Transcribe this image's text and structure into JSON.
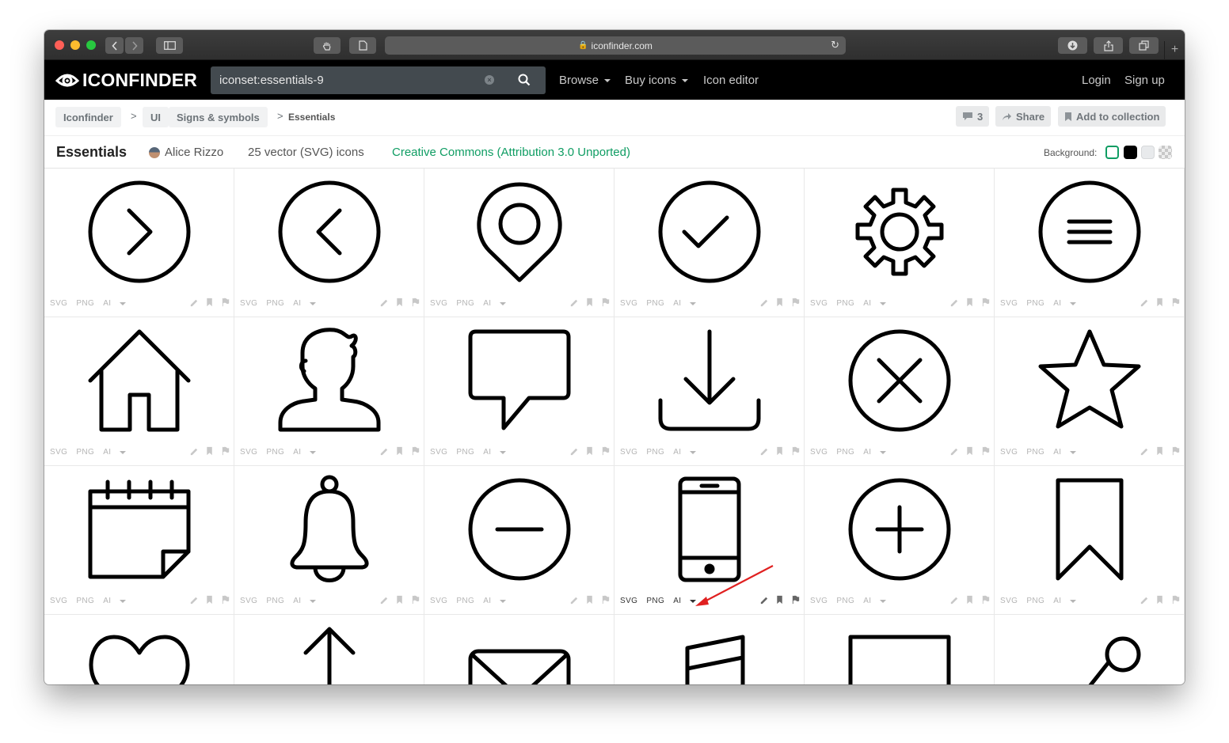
{
  "browser": {
    "url": "iconfinder.com",
    "new_tab_glyph": "+"
  },
  "header": {
    "logo_text": "ICONFINDER",
    "search_value": "iconset:essentials-9",
    "nav": [
      {
        "label": "Browse",
        "has_caret": true
      },
      {
        "label": "Buy icons",
        "has_caret": true
      },
      {
        "label": "Icon editor",
        "has_caret": false
      }
    ],
    "login": "Login",
    "signup": "Sign up"
  },
  "breadcrumb": {
    "items": [
      "Iconfinder",
      "UI",
      "Signs & symbols"
    ],
    "current": "Essentials",
    "separator": ">"
  },
  "actions": {
    "comments_count": "3",
    "share": "Share",
    "add_collection": "Add to collection"
  },
  "iconset": {
    "title": "Essentials",
    "author": "Alice Rizzo",
    "count_text": "25 vector (SVG) icons",
    "license": "Creative Commons (Attribution 3.0 Unported)",
    "background_label": "Background:",
    "background_options": [
      "#ffffff",
      "#000000",
      "#e8eaec",
      "checker"
    ],
    "background_selected": "#ffffff"
  },
  "formats": [
    "SVG",
    "PNG",
    "AI"
  ],
  "icons": [
    "chevron-right-circle",
    "chevron-left-circle",
    "location-pin",
    "check-circle",
    "gear",
    "menu-circle",
    "home",
    "user",
    "speech-bubble",
    "download",
    "close-circle",
    "star",
    "calendar",
    "bell",
    "minus-circle",
    "smartphone",
    "plus-circle",
    "bookmark",
    "heart",
    "arrow-up",
    "mail",
    "music",
    "square",
    "share"
  ],
  "highlighted_icon": "smartphone",
  "colors": {
    "accent_green": "#0f9d63",
    "annotation_arrow": "#e02020",
    "header_bg": "#000000"
  }
}
